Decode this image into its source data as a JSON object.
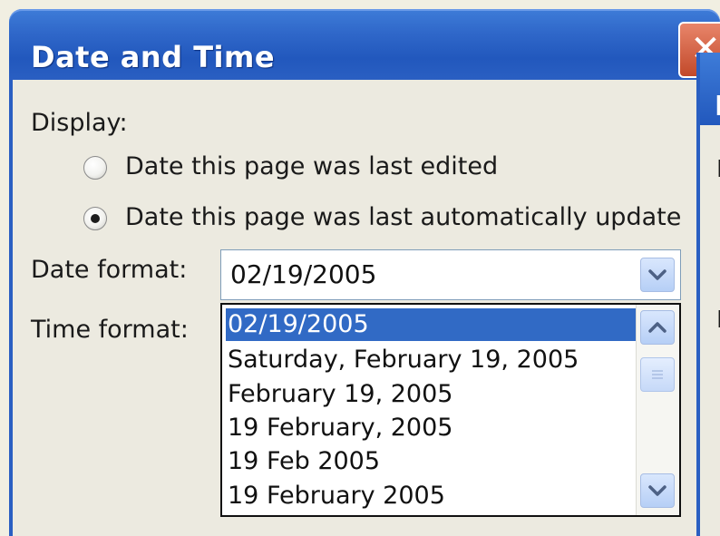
{
  "window": {
    "title": "Date and Time",
    "close_glyph": "✕"
  },
  "display": {
    "label": "Display:",
    "options": [
      {
        "label": "Date this page was last edited",
        "selected": false
      },
      {
        "label": "Date this page was last automatically update",
        "selected": true
      }
    ]
  },
  "date_format": {
    "label": "Date format:",
    "value": "02/19/2005",
    "list": [
      "02/19/2005",
      "Saturday, February 19, 2005",
      "February 19, 2005",
      "19 February, 2005",
      "19 Feb 2005",
      "19 February 2005"
    ],
    "selected_index": 0
  },
  "time_format": {
    "label": "Time format:"
  },
  "background_window": {
    "title_glyph": "D"
  },
  "icons": {
    "combo_arrow": "chevron-down-icon",
    "scroll_up": "chevron-up-icon",
    "scroll_down": "chevron-down-icon",
    "close": "close-icon"
  },
  "colors": {
    "titlebar": "#2258bd",
    "selection": "#316ac5",
    "dialog_bg": "#eceae0"
  }
}
